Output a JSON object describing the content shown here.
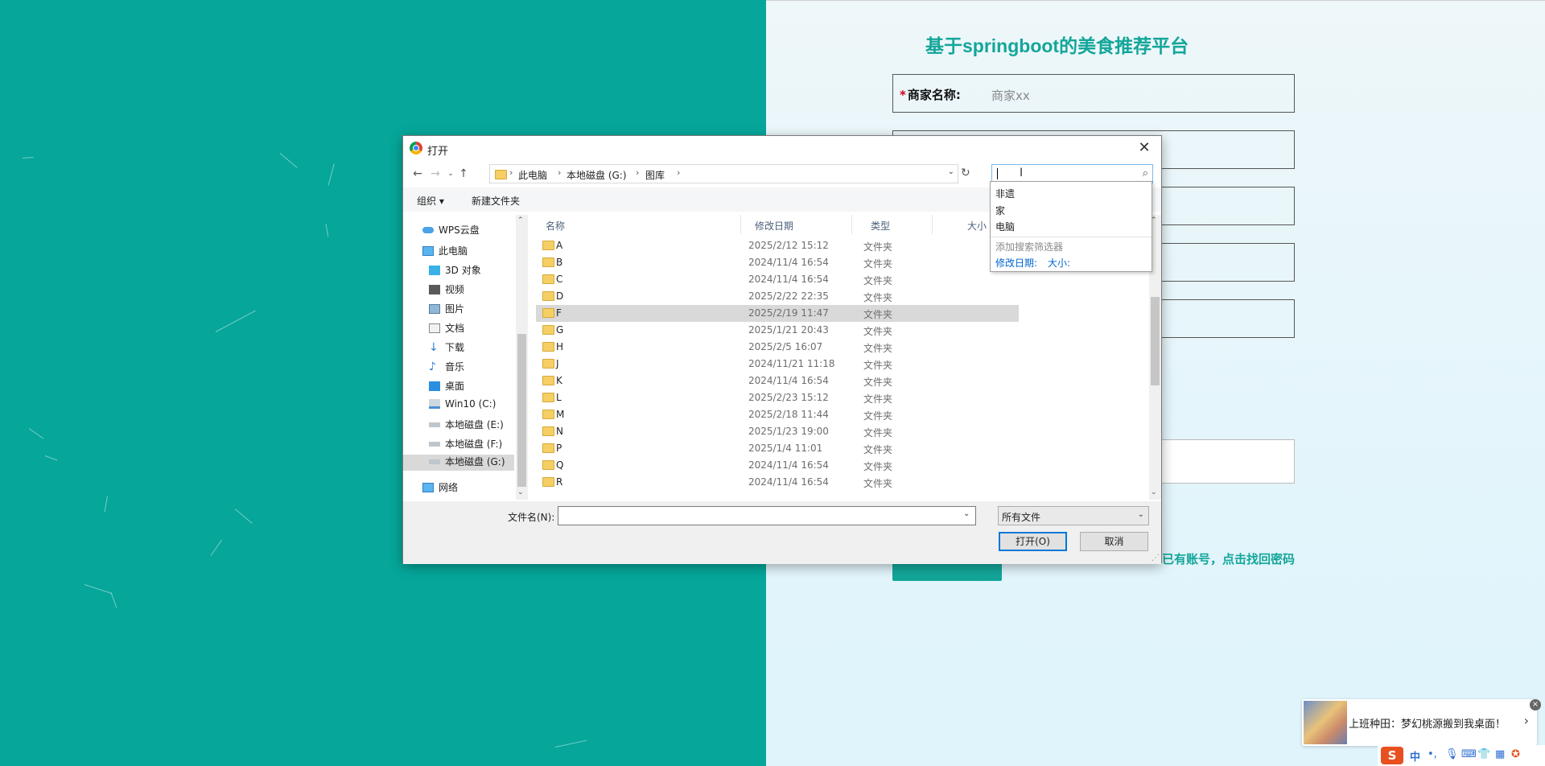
{
  "page": {
    "title": "基于springboot的美食推荐平台",
    "form": {
      "merchant_label": "商家名称:",
      "merchant_required": "*",
      "merchant_value": "商家xx"
    },
    "find_password_link": "已有账号，点击找回密码"
  },
  "dialog": {
    "title": "打开",
    "close_glyph": "✕",
    "breadcrumb": [
      "此电脑",
      "本地磁盘 (G:)",
      "图库"
    ],
    "toolbar": {
      "organize_label": "组织 ▾",
      "new_folder_label": "新建文件夹"
    },
    "nav_items": [
      {
        "label": "WPS云盘",
        "icon": "cloud-icon"
      },
      {
        "label": "此电脑",
        "icon": "computer-icon"
      },
      {
        "label": "3D 对象",
        "icon": "cube-icon"
      },
      {
        "label": "视频",
        "icon": "video-icon"
      },
      {
        "label": "图片",
        "icon": "picture-icon"
      },
      {
        "label": "文档",
        "icon": "document-icon"
      },
      {
        "label": "下载",
        "icon": "download-icon"
      },
      {
        "label": "音乐",
        "icon": "music-icon"
      },
      {
        "label": "桌面",
        "icon": "desktop-icon"
      },
      {
        "label": "Win10 (C:)",
        "icon": "drive-icon"
      },
      {
        "label": "本地磁盘 (E:)",
        "icon": "drive-icon"
      },
      {
        "label": "本地磁盘 (F:)",
        "icon": "drive-icon"
      },
      {
        "label": "本地磁盘 (G:)",
        "icon": "drive-icon",
        "selected": true
      },
      {
        "label": "网络",
        "icon": "network-icon"
      }
    ],
    "columns": {
      "name": "名称",
      "modified": "修改日期",
      "type": "类型",
      "size": "大小"
    },
    "files": [
      {
        "name": "A",
        "modified": "2025/2/12 15:12",
        "type": "文件夹"
      },
      {
        "name": "B",
        "modified": "2024/11/4 16:54",
        "type": "文件夹"
      },
      {
        "name": "C",
        "modified": "2024/11/4 16:54",
        "type": "文件夹"
      },
      {
        "name": "D",
        "modified": "2025/2/22 22:35",
        "type": "文件夹"
      },
      {
        "name": "F",
        "modified": "2025/2/19 11:47",
        "type": "文件夹",
        "selected": true
      },
      {
        "name": "G",
        "modified": "2025/1/21 20:43",
        "type": "文件夹"
      },
      {
        "name": "H",
        "modified": "2025/2/5 16:07",
        "type": "文件夹"
      },
      {
        "name": "J",
        "modified": "2024/11/21 11:18",
        "type": "文件夹"
      },
      {
        "name": "K",
        "modified": "2024/11/4 16:54",
        "type": "文件夹"
      },
      {
        "name": "L",
        "modified": "2025/2/23 15:12",
        "type": "文件夹"
      },
      {
        "name": "M",
        "modified": "2025/2/18 11:44",
        "type": "文件夹"
      },
      {
        "name": "N",
        "modified": "2025/1/23 19:00",
        "type": "文件夹"
      },
      {
        "name": "P",
        "modified": "2025/1/4 11:01",
        "type": "文件夹"
      },
      {
        "name": "Q",
        "modified": "2024/11/4 16:54",
        "type": "文件夹"
      },
      {
        "name": "R",
        "modified": "2024/11/4 16:54",
        "type": "文件夹"
      }
    ],
    "search": {
      "value": "",
      "suggestions": [
        "非遗",
        "家",
        "电脑"
      ],
      "filter_hint": "添加搜索筛选器",
      "filter_modified": "修改日期:",
      "filter_size": "大小:"
    },
    "filename_label": "文件名(N):",
    "filename_value": "",
    "filetype_value": "所有文件",
    "open_button": "打开(O)",
    "cancel_button": "取消"
  },
  "notification": {
    "text": "上班种田：梦幻桃源搬到我桌面！",
    "arrow": "›",
    "close": "×"
  },
  "ime": {
    "logo": "S",
    "lang": "中"
  },
  "colors": {
    "teal": "#06a69a",
    "accent_text": "#14a69a",
    "selection": "#d9d9d9",
    "link_blue": "#0066cc"
  }
}
